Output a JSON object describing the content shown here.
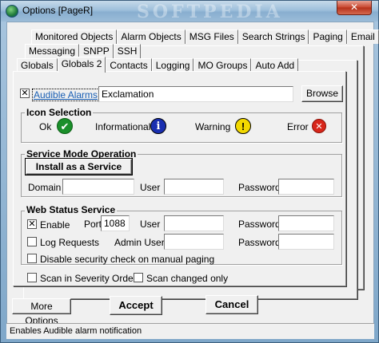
{
  "window": {
    "title": "Options [PageR]",
    "watermark": "SOFTPEDIA",
    "close_glyph": "✕"
  },
  "tabs": {
    "row1": [
      "Monitored Objects",
      "Alarm Objects",
      "MSG Files",
      "Search Strings",
      "Paging",
      "Email"
    ],
    "row2": [
      "Messaging",
      "SNPP",
      "SSH"
    ],
    "row3": [
      "Globals",
      "Globals 2",
      "Contacts",
      "Logging",
      "MO Groups",
      "Auto Add"
    ],
    "active": "Globals 2"
  },
  "audible": {
    "checked": true,
    "label": "Audible Alarms",
    "value": "Exclamation",
    "browse_label": "Browse"
  },
  "icon_selection": {
    "title": "Icon Selection",
    "ok_label": "Ok",
    "info_label": "Informational",
    "warning_label": "Warning",
    "error_label": "Error",
    "ok_icon": "check-icon",
    "info_icon": "info-icon",
    "warning_icon": "warning-icon",
    "error_icon": "error-icon"
  },
  "service_mode": {
    "title": "Service Mode Operation",
    "install_label": "Install as a Service",
    "domain_label": "Domain",
    "domain_value": "",
    "user_label": "User",
    "user_value": "",
    "password_label": "Password",
    "password_value": ""
  },
  "web_status": {
    "title": "Web Status Service",
    "enable_label": "Enable",
    "enable_checked": true,
    "port_label": "Port",
    "port_value": "1088",
    "user_label": "User",
    "user_value": "",
    "password_label": "Password",
    "password_value": "",
    "log_label": "Log Requests",
    "log_checked": false,
    "admin_user_label": "Admin User",
    "admin_user_value": "",
    "admin_password_label": "Password",
    "admin_password_value": "",
    "disable_security_label": "Disable security check on manual paging",
    "disable_security_checked": false
  },
  "scan": {
    "severity_label": "Scan in Severity Order",
    "severity_checked": false,
    "changed_label": "Scan changed only",
    "changed_checked": false
  },
  "buttons": {
    "more_options": "More Options",
    "accept": "Accept",
    "cancel": "Cancel"
  },
  "status_text": "Enables Audible alarm notification",
  "colors": {
    "ok": "#1a8f2a",
    "info": "#1a2fb0",
    "warning": "#f2d800",
    "error": "#d8261a"
  }
}
